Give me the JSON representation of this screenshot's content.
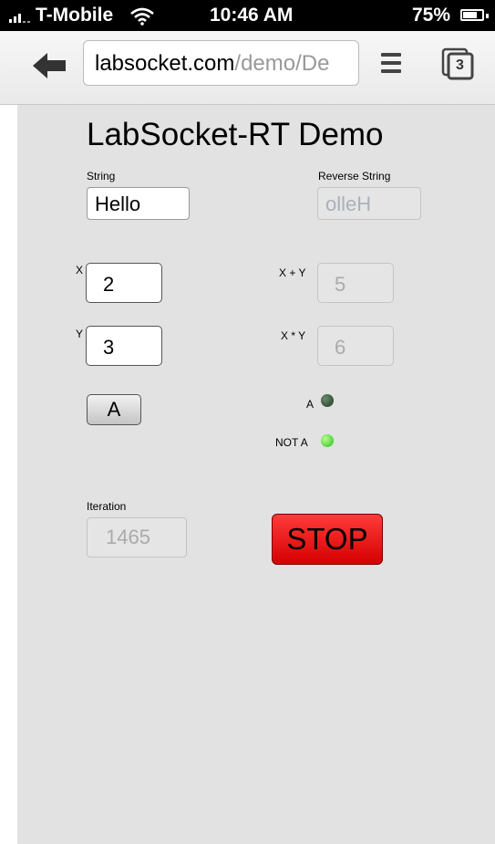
{
  "status_bar": {
    "carrier": "T-Mobile",
    "time": "10:46 AM",
    "battery": "75%",
    "battery_level": 0.75
  },
  "browser": {
    "url_host": "labsocket.com",
    "url_rest": "/demo/De",
    "tab_count": "3",
    "icons": [
      "back-arrow-icon",
      "menu-icon",
      "tabs-icon",
      "wifi-icon",
      "signal-icon",
      "battery-icon"
    ]
  },
  "demo": {
    "title": "LabSocket-RT Demo",
    "string_label": "String",
    "string_value": "Hello",
    "reverse_label": "Reverse String",
    "reverse_value": "olleH",
    "x_label": "X",
    "x_value": "2",
    "y_label": "Y",
    "y_value": "3",
    "sum_label": "X + Y",
    "sum_value": "5",
    "product_label": "X * Y",
    "product_value": "6",
    "button_a": "A",
    "led_a_label": "A",
    "led_a_on": false,
    "led_not_a_label": "NOT A",
    "led_not_a_on": true,
    "iteration_label": "Iteration",
    "iteration_value": "1465",
    "stop_label": "STOP",
    "colors": {
      "stop": "#e60000",
      "led_on": "#35c91f",
      "led_off": "#2a4a2a",
      "page_bg": "#e2e2e2"
    }
  }
}
